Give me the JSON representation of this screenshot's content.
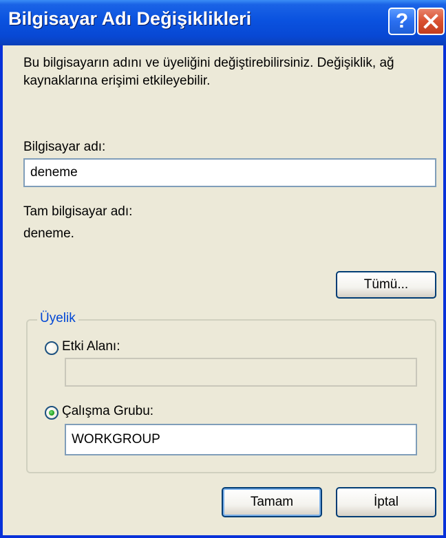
{
  "window": {
    "title": "Bilgisayar Adı Değişiklikleri",
    "help_label": "?"
  },
  "description": "Bu bilgisayarın adını ve üyeliğini değiştirebilirsiniz. Değişiklik, ağ kaynaklarına erişimi etkileyebilir.",
  "computer_name": {
    "label": "Bilgisayar adı:",
    "value": "deneme"
  },
  "full_name": {
    "label": "Tam bilgisayar adı:",
    "value": "deneme."
  },
  "more_button": "Tümü...",
  "membership": {
    "legend": "Üyelik",
    "domain": {
      "label": "Etki Alanı:",
      "value": "",
      "selected": false,
      "enabled": false
    },
    "workgroup": {
      "label": "Çalışma Grubu:",
      "value": "WORKGROUP",
      "selected": true,
      "enabled": true
    }
  },
  "buttons": {
    "ok": "Tamam",
    "cancel": "İptal"
  },
  "colors": {
    "titlebar": "#0a52df",
    "frame": "#0831d9",
    "dialog_bg": "#ece9d8",
    "close_button": "#d9502f",
    "group_legend": "#0046d5"
  },
  "icons": {
    "help": "question-mark-icon",
    "close": "close-x-icon"
  }
}
